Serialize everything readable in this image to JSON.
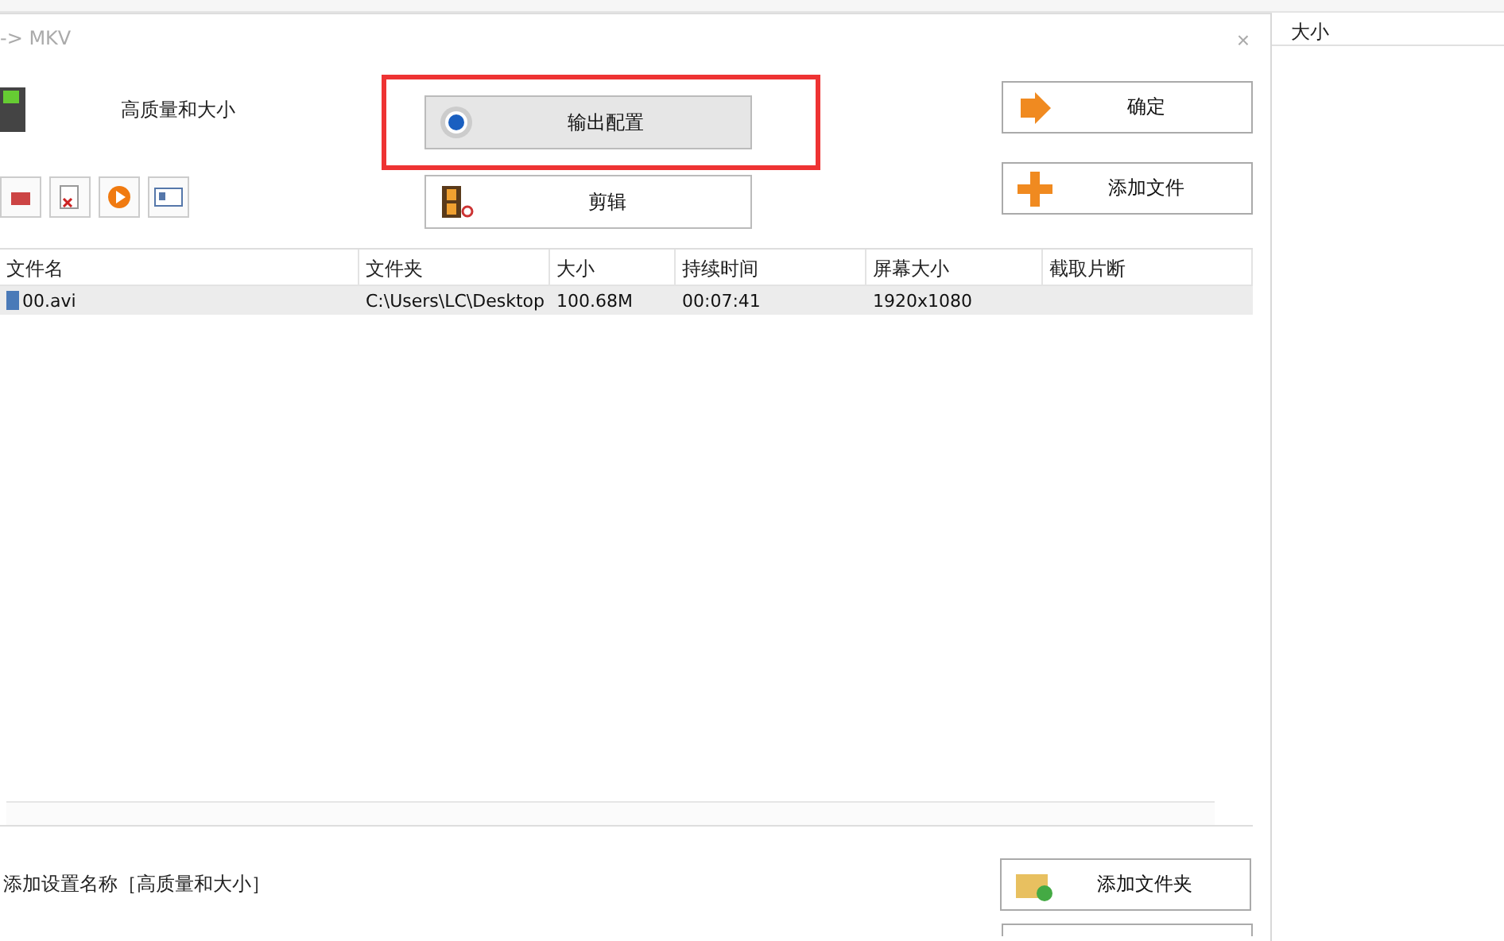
{
  "background": {
    "column_header": "大小"
  },
  "dialog": {
    "title": "-> MKV",
    "preset_name": "高质量和大小",
    "close": "×",
    "middle_buttons": [
      {
        "label": "输出配置",
        "highlighted": true
      },
      {
        "label": "剪辑",
        "highlighted": false
      }
    ],
    "right_buttons": [
      {
        "label": "确定"
      },
      {
        "label": "添加文件"
      }
    ],
    "table": {
      "columns": [
        "文件名",
        "文件夹",
        "大小",
        "持续时间",
        "屏幕大小",
        "截取片断"
      ],
      "rows": [
        {
          "selected": true,
          "cells": [
            "00.avi",
            "C:\\Users\\LC\\Desktop",
            "100.68M",
            "00:07:41",
            "1920x1080",
            ""
          ]
        }
      ]
    },
    "footer_text": "添加设置名称［高质量和大小］",
    "footer_button": {
      "label": "添加文件夹"
    }
  }
}
